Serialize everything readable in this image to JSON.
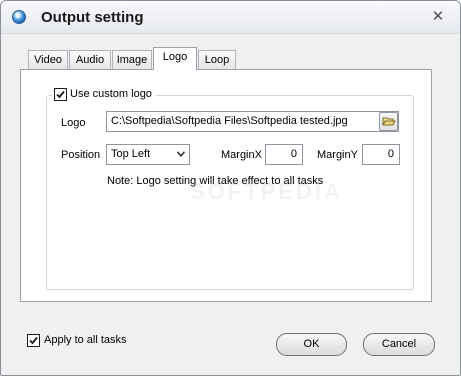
{
  "window": {
    "title": "Output setting",
    "close_glyph": "✕"
  },
  "tabs": [
    {
      "label": "Video"
    },
    {
      "label": "Audio"
    },
    {
      "label": "Image"
    },
    {
      "label": "Logo",
      "active": true
    },
    {
      "label": "Loop"
    }
  ],
  "logo_group": {
    "use_custom_logo": {
      "label": "Use custom logo",
      "checked": true
    },
    "logo": {
      "label": "Logo",
      "value": "C:\\Softpedia\\Softpedia Files\\Softpedia tested.jpg"
    },
    "position": {
      "label": "Position",
      "selected": "Top Left"
    },
    "margin_x": {
      "label": "MarginX",
      "value": "0"
    },
    "margin_y": {
      "label": "MarginY",
      "value": "0"
    },
    "note": "Note: Logo setting will take effect to all tasks"
  },
  "watermark": "SOFTPEDIA",
  "footer": {
    "apply_all": {
      "label": "Apply to all tasks",
      "checked": true
    },
    "ok_label": "OK",
    "cancel_label": "Cancel"
  },
  "icons": {
    "app": "app-icon",
    "close": "close-icon",
    "browse": "folder-open-icon",
    "checkmark": "checkmark-icon",
    "dropdown": "chevron-down-icon"
  }
}
